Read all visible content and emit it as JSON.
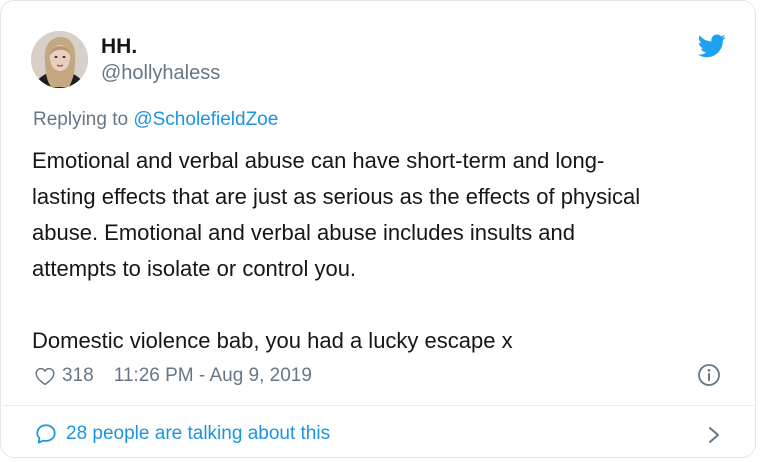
{
  "tweet": {
    "display_name": "HH.",
    "handle": "@hollyhaless",
    "reply_prefix": "Replying to ",
    "reply_to": "@ScholefieldZoe",
    "body": "Emotional and verbal abuse can have short-term and long-\nlasting effects that are just as serious as the effects of physical\nabuse. Emotional and verbal abuse includes insults and\nattempts to isolate or control you.\n\nDomestic violence bab, you had a lucky escape x",
    "likes": "318",
    "timestamp": "11:26 PM - Aug 9, 2019",
    "talking": "28 people are talking about this"
  },
  "icons": {
    "logo": "twitter-bird-icon",
    "like": "heart-icon",
    "info": "info-icon",
    "conversation": "speech-bubble-icon",
    "more": "chevron-right-icon"
  },
  "colors": {
    "accent": "#1b95e0",
    "muted": "#657786",
    "text": "#14171a",
    "border": "#e1e8ed"
  }
}
